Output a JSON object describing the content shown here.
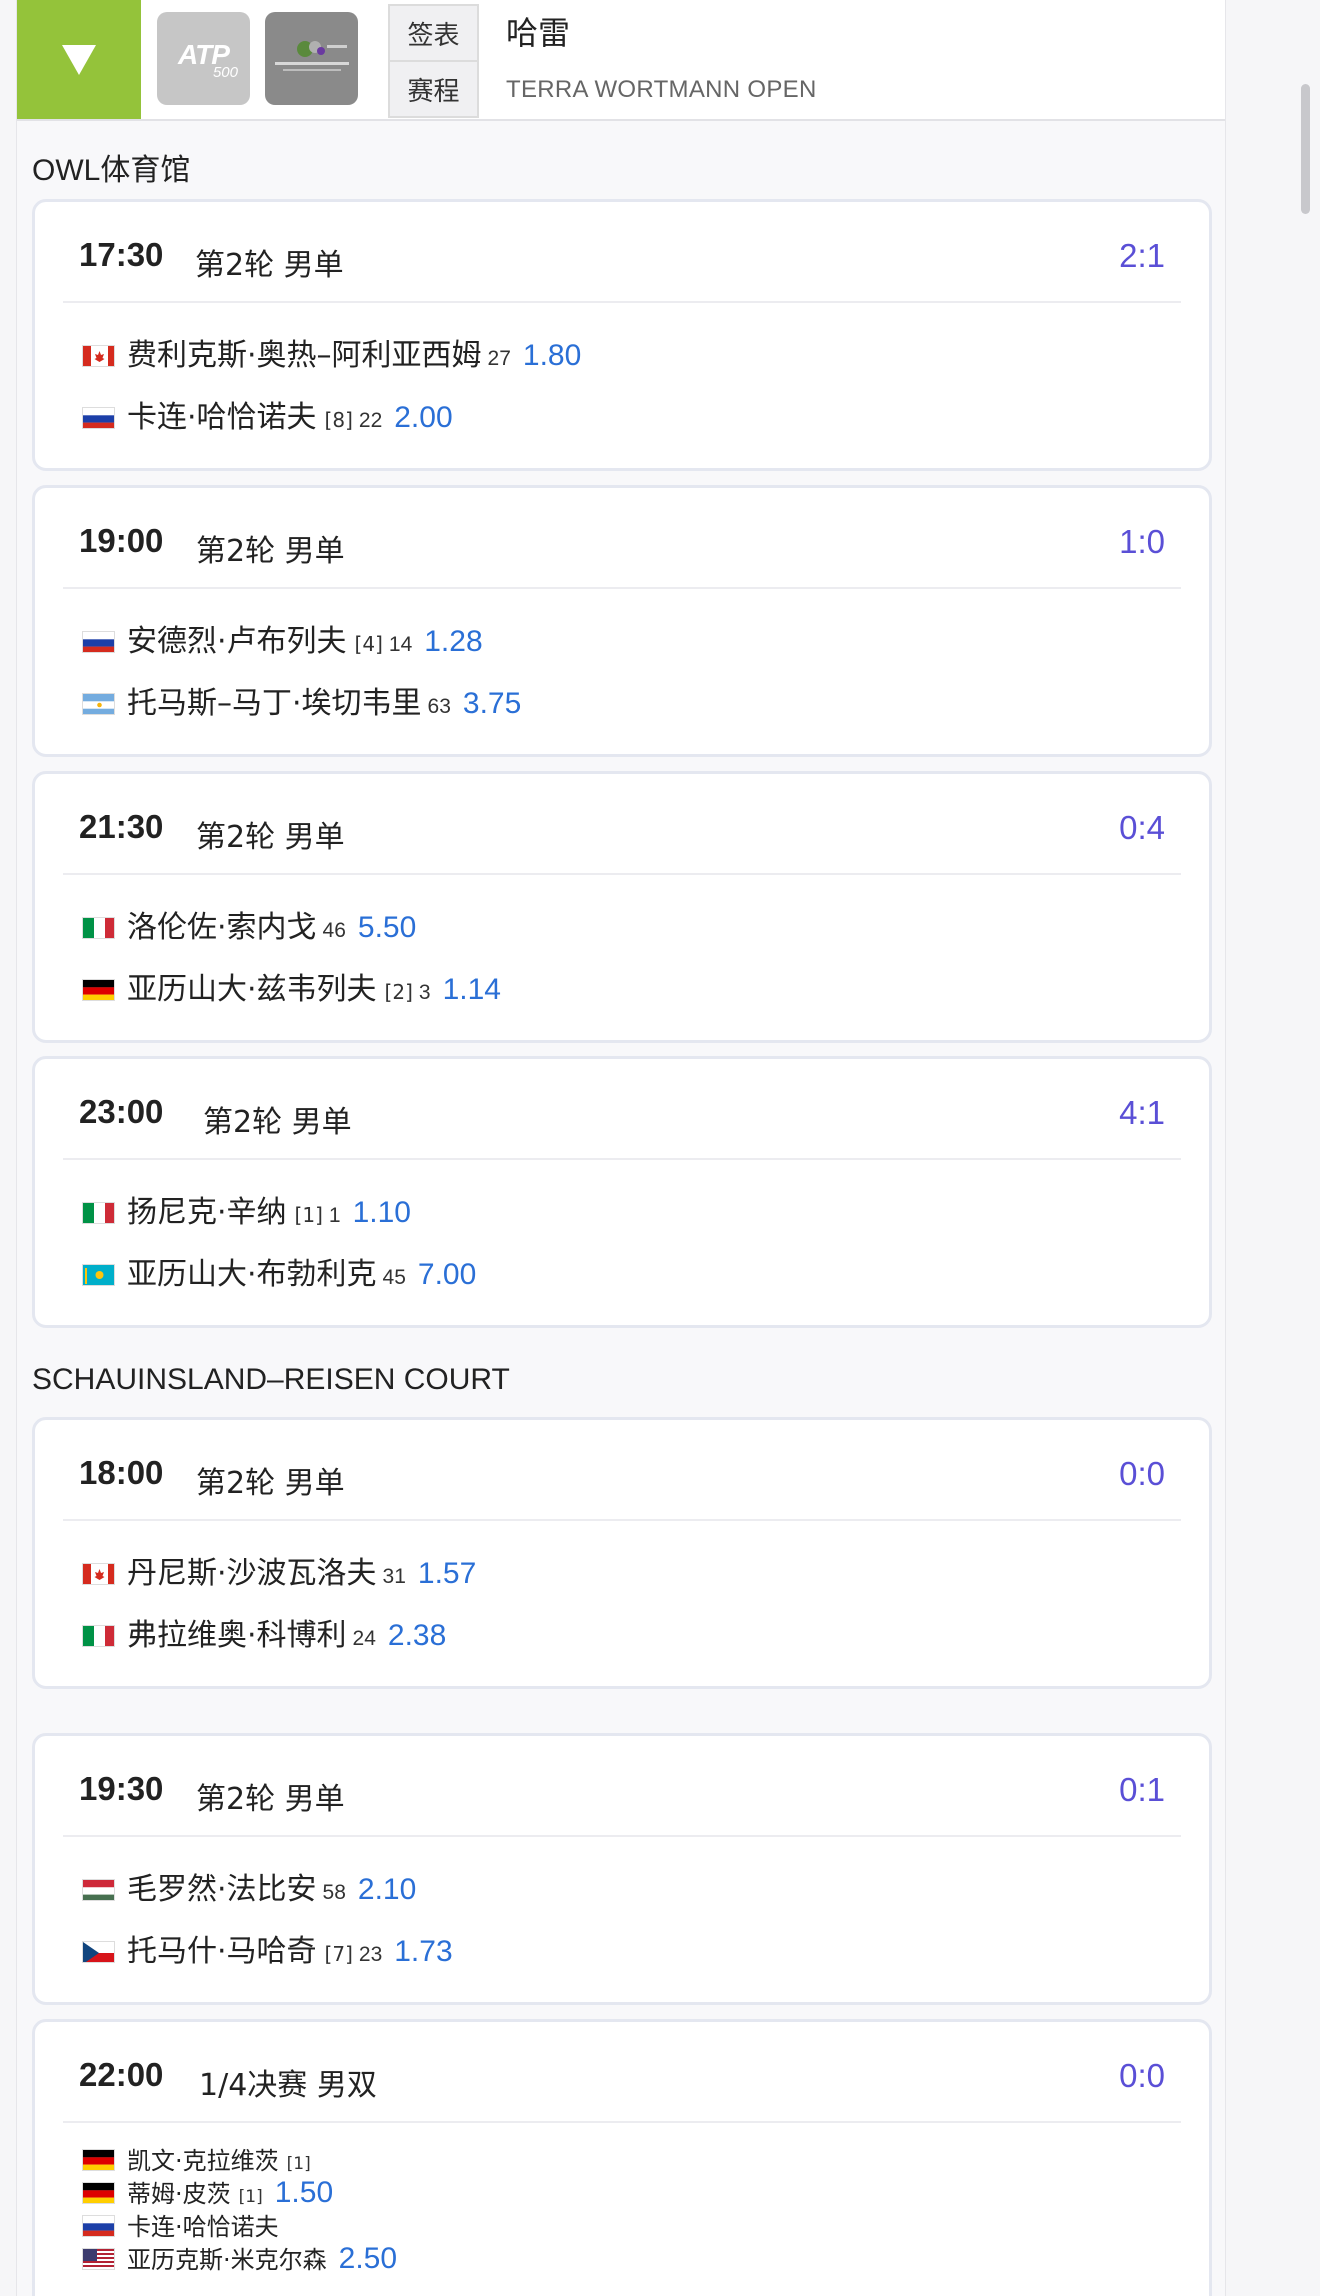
{
  "header": {
    "toggle_icon": "triangle-down-icon",
    "logos": [
      "atp-500-logo",
      "terra-wortmann-open-logo"
    ],
    "atp_logo_text": "ATP",
    "atp_logo_500": "500",
    "tabs": [
      {
        "label": "签表"
      },
      {
        "label": "赛程"
      }
    ],
    "city": "哈雷",
    "tournament": "TERRA WORTMANN OPEN",
    "accent_color": "#94c33a"
  },
  "colors": {
    "score": "#5a4fd6",
    "odds": "#2a6fd6"
  },
  "venues": [
    {
      "name": "OWL体育馆",
      "matches": [
        {
          "time": "17:30",
          "round": "第2轮 男单",
          "score": "2:1",
          "players": [
            {
              "flag": "CA",
              "name": "费利克斯·奥热–阿利亚西姆",
              "seed": "",
              "rank": "27",
              "odds": "1.80"
            },
            {
              "flag": "RU",
              "name": "卡连·哈恰诺夫",
              "seed": "[8]",
              "rank": "22",
              "odds": "2.00"
            }
          ]
        },
        {
          "time": "19:00",
          "round": "第2轮 男单",
          "score": "1:0",
          "players": [
            {
              "flag": "RU",
              "name": "安德烈·卢布列夫",
              "seed": "[4]",
              "rank": "14",
              "odds": "1.28"
            },
            {
              "flag": "AR",
              "name": "托马斯–马丁·埃切韦里",
              "seed": "",
              "rank": "63",
              "odds": "3.75"
            }
          ]
        },
        {
          "time": "21:30",
          "round": "第2轮 男单",
          "score": "0:4",
          "players": [
            {
              "flag": "IT",
              "name": "洛伦佐·索内戈",
              "seed": "",
              "rank": "46",
              "odds": "5.50"
            },
            {
              "flag": "DE",
              "name": "亚历山大·兹韦列夫",
              "seed": "[2]",
              "rank": "3",
              "odds": "1.14"
            }
          ]
        },
        {
          "time": "23:00",
          "round": "第2轮 男单",
          "score": "4:1",
          "players": [
            {
              "flag": "IT",
              "name": "扬尼克·辛纳",
              "seed": "[1]",
              "rank": "1",
              "odds": "1.10"
            },
            {
              "flag": "KZ",
              "name": "亚历山大·布勃利克",
              "seed": "",
              "rank": "45",
              "odds": "7.00"
            }
          ]
        }
      ]
    },
    {
      "name": "SCHAUINSLAND–REISEN COURT",
      "matches": [
        {
          "time": "18:00",
          "round": "第2轮 男单",
          "score": "0:0",
          "players": [
            {
              "flag": "CA",
              "name": "丹尼斯·沙波瓦洛夫",
              "seed": "",
              "rank": "31",
              "odds": "1.57"
            },
            {
              "flag": "IT",
              "name": "弗拉维奥·科博利",
              "seed": "",
              "rank": "24",
              "odds": "2.38"
            }
          ]
        },
        {
          "time": "19:30",
          "round": "第2轮 男单",
          "score": "0:1",
          "players": [
            {
              "flag": "HU",
              "name": "毛罗然·法比安",
              "seed": "",
              "rank": "58",
              "odds": "2.10"
            },
            {
              "flag": "CZ",
              "name": "托马什·马哈奇",
              "seed": "[7]",
              "rank": "23",
              "odds": "1.73"
            }
          ]
        },
        {
          "time": "22:00",
          "round": "1/4决赛 男双",
          "score": "0:0",
          "players": [
            {
              "flag": "DE",
              "name": "凯文·克拉维茨",
              "seed": "[1]",
              "rank": "",
              "odds": ""
            },
            {
              "flag": "DE",
              "name": "蒂姆·皮茨",
              "seed": "[1]",
              "rank": "",
              "odds": "1.50"
            },
            {
              "flag": "RU",
              "name": "卡连·哈恰诺夫",
              "seed": "",
              "rank": "",
              "odds": ""
            },
            {
              "flag": "US",
              "name": "亚历克斯·米克尔森",
              "seed": "",
              "rank": "",
              "odds": "2.50"
            }
          ]
        }
      ]
    }
  ]
}
